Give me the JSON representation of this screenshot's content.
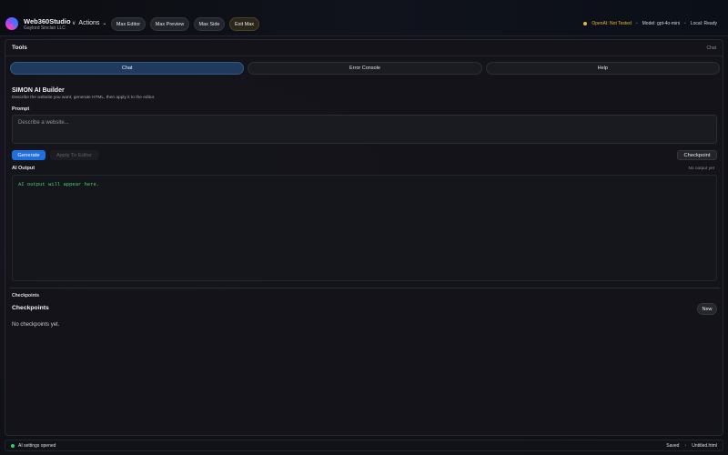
{
  "header": {
    "brand_name": "Web360Studio",
    "brand_sub": "Gaylord Sinclair LLC",
    "actions_label": "Actions",
    "buttons": {
      "max_editor": "Max Editor",
      "max_preview": "Max Preview",
      "max_side": "Max Side",
      "exit_max": "Exit Max"
    },
    "status": {
      "openai": "OpenAI: Not Tested",
      "separator": "•",
      "model": "Model: gpt-4o-mini",
      "local": "Local: Ready"
    }
  },
  "tools": {
    "title": "Tools",
    "crumb": "Chat",
    "tabs": [
      "Chat",
      "Error Console",
      "Help"
    ],
    "active_tab": "Chat"
  },
  "builder": {
    "title": "SIMON AI Builder",
    "subtitle": "Describe the website you want, generate HTML, then apply it to the editor.",
    "prompt_label": "Prompt",
    "prompt_placeholder": "Describe a website...",
    "generate_label": "Generate",
    "apply_label": "Apply To Editor",
    "checkpoint_label": "Checkpoint",
    "output_label": "AI Output",
    "output_status": "No output yet",
    "output_placeholder": "AI output will appear here."
  },
  "checkpoints": {
    "section_label": "Checkpoints",
    "title": "Checkpoints",
    "new_label": "New",
    "empty_text": "No checkpoints yet."
  },
  "statusbar": {
    "message": "AI settings opened",
    "saved": "Saved",
    "separator": "•",
    "filename": "Untitled.html"
  },
  "colors": {
    "accent": "#1e6fe0",
    "active_tab": "#1f3a5c",
    "warning": "#f2b233",
    "success": "#31d06a",
    "output_text": "#46d36a"
  },
  "icons": {
    "logo": "gradient-orb-logo-icon",
    "actions": "chevron-down-icon"
  }
}
